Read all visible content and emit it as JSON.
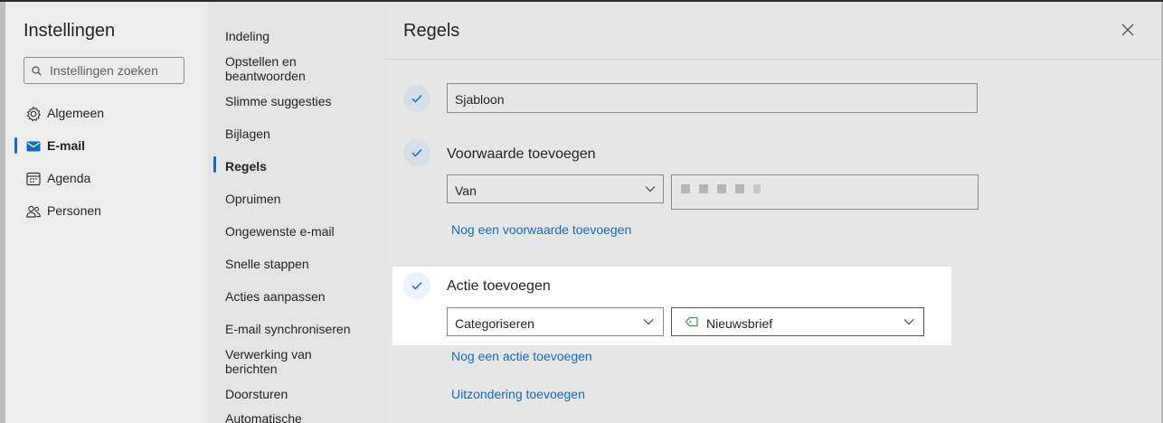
{
  "settings": {
    "title": "Instellingen",
    "search_placeholder": "Instellingen zoeken",
    "nav": [
      {
        "label": "Algemeen",
        "icon": "gear-icon"
      },
      {
        "label": "E-mail",
        "icon": "mail-icon"
      },
      {
        "label": "Agenda",
        "icon": "calendar-icon"
      },
      {
        "label": "Personen",
        "icon": "people-icon"
      }
    ],
    "active_nav": "E-mail"
  },
  "mail_settings": {
    "items": [
      "Indeling",
      "Opstellen en beantwoorden",
      "Slimme suggesties",
      "Bijlagen",
      "Regels",
      "Opruimen",
      "Ongewenste e-mail",
      "Snelle stappen",
      "Acties aanpassen",
      "E-mail synchroniseren",
      "Verwerking van berichten",
      "Doorsturen",
      "Automatische"
    ],
    "active": "Regels"
  },
  "rules": {
    "title": "Regels",
    "name_value": "Sjabloon",
    "condition": {
      "label": "Voorwaarde toevoegen",
      "select_value": "Van",
      "add_link": "Nog een voorwaarde toevoegen"
    },
    "action": {
      "label": "Actie toevoegen",
      "select_value": "Categoriseren",
      "category_value": "Nieuwsbrief",
      "add_link": "Nog een actie toevoegen"
    },
    "exception_link": "Uitzondering toevoegen"
  },
  "colors": {
    "accent": "#0f6cbd",
    "highlight": "#ffffff",
    "tag": "#2e9e4a"
  }
}
